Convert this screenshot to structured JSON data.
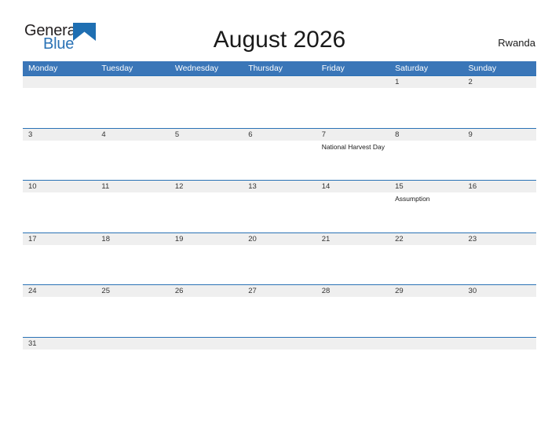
{
  "brand": {
    "name_part1": "General",
    "name_part2": "Blue",
    "triangle_icon": "triangle-logo-icon",
    "accent_color": "#2a72b5"
  },
  "header": {
    "title": "August 2026",
    "country": "Rwanda"
  },
  "calendar": {
    "month": "August",
    "year": "2026",
    "header_bg": "#3a76b8",
    "row_line_color": "#2a72b5",
    "number_band_bg": "#efefef",
    "weekdays": [
      "Monday",
      "Tuesday",
      "Wednesday",
      "Thursday",
      "Friday",
      "Saturday",
      "Sunday"
    ],
    "weeks": [
      [
        {
          "day": "",
          "event": ""
        },
        {
          "day": "",
          "event": ""
        },
        {
          "day": "",
          "event": ""
        },
        {
          "day": "",
          "event": ""
        },
        {
          "day": "",
          "event": ""
        },
        {
          "day": "1",
          "event": ""
        },
        {
          "day": "2",
          "event": ""
        }
      ],
      [
        {
          "day": "3",
          "event": ""
        },
        {
          "day": "4",
          "event": ""
        },
        {
          "day": "5",
          "event": ""
        },
        {
          "day": "6",
          "event": ""
        },
        {
          "day": "7",
          "event": "National Harvest Day"
        },
        {
          "day": "8",
          "event": ""
        },
        {
          "day": "9",
          "event": ""
        }
      ],
      [
        {
          "day": "10",
          "event": ""
        },
        {
          "day": "11",
          "event": ""
        },
        {
          "day": "12",
          "event": ""
        },
        {
          "day": "13",
          "event": ""
        },
        {
          "day": "14",
          "event": ""
        },
        {
          "day": "15",
          "event": "Assumption"
        },
        {
          "day": "16",
          "event": ""
        }
      ],
      [
        {
          "day": "17",
          "event": ""
        },
        {
          "day": "18",
          "event": ""
        },
        {
          "day": "19",
          "event": ""
        },
        {
          "day": "20",
          "event": ""
        },
        {
          "day": "21",
          "event": ""
        },
        {
          "day": "22",
          "event": ""
        },
        {
          "day": "23",
          "event": ""
        }
      ],
      [
        {
          "day": "24",
          "event": ""
        },
        {
          "day": "25",
          "event": ""
        },
        {
          "day": "26",
          "event": ""
        },
        {
          "day": "27",
          "event": ""
        },
        {
          "day": "28",
          "event": ""
        },
        {
          "day": "29",
          "event": ""
        },
        {
          "day": "30",
          "event": ""
        }
      ],
      [
        {
          "day": "31",
          "event": ""
        },
        {
          "day": "",
          "event": ""
        },
        {
          "day": "",
          "event": ""
        },
        {
          "day": "",
          "event": ""
        },
        {
          "day": "",
          "event": ""
        },
        {
          "day": "",
          "event": ""
        },
        {
          "day": "",
          "event": ""
        }
      ]
    ]
  }
}
